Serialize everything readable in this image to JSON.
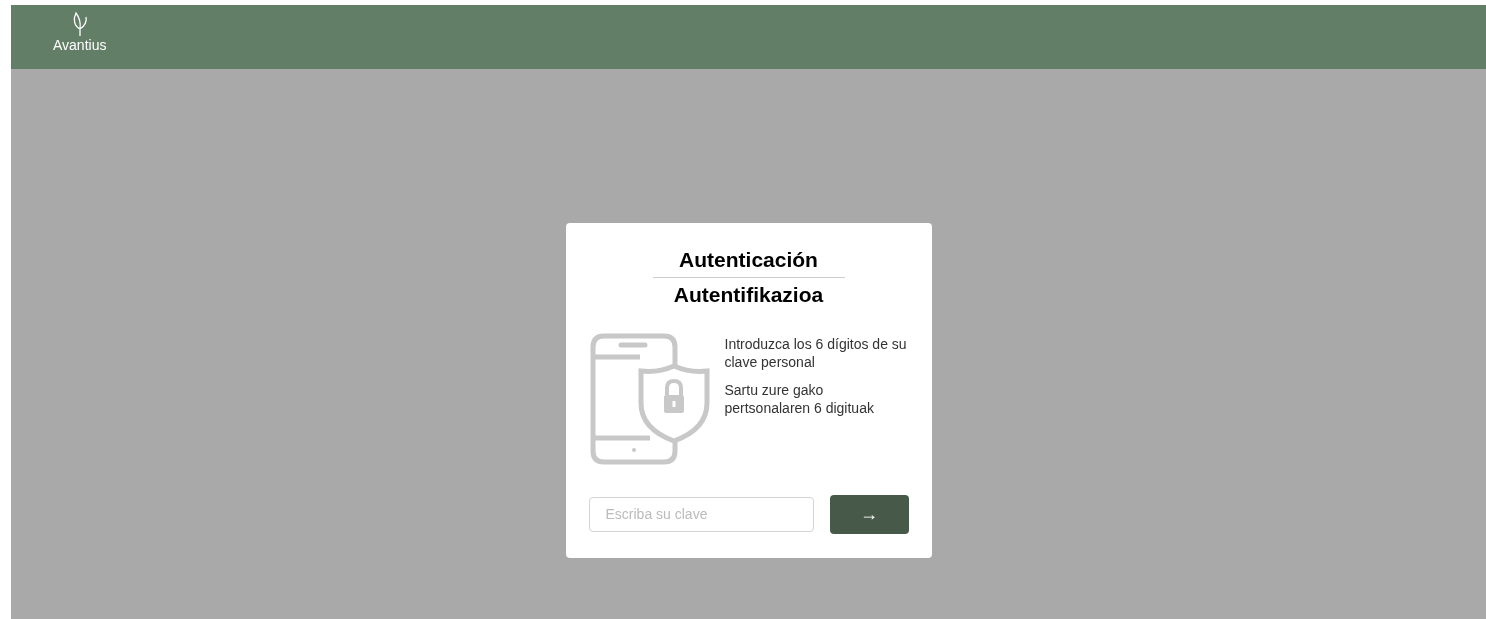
{
  "header": {
    "brand": "Avantius"
  },
  "dialog": {
    "title": "Autenticación",
    "subtitle": "Autentifikazioa",
    "instructions": [
      "Introduzca los 6 dígitos de su clave personal",
      "Sartu zure gako pertsonalaren 6 digituak"
    ],
    "field": {
      "placeholder": "Escriba su clave"
    },
    "submit": {
      "label": "→"
    }
  }
}
